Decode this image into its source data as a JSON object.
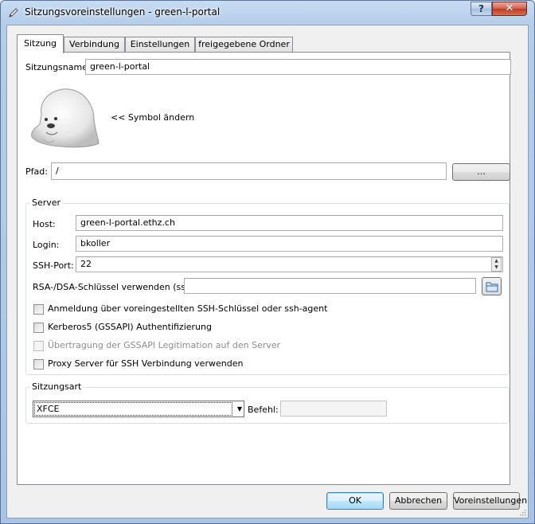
{
  "window": {
    "title": "Sitzungsvoreinstellungen - green-l-portal",
    "help_glyph": "?",
    "close_glyph": "✕"
  },
  "tabs": [
    {
      "label": "Sitzung",
      "active": true
    },
    {
      "label": "Verbindung"
    },
    {
      "label": "Einstellungen"
    },
    {
      "label": "freigegebene Ordner"
    }
  ],
  "session": {
    "name_label": "Sitzungsname:",
    "name_value": "green-l-portal",
    "change_icon_label": "<< Symbol ändern",
    "path_label": "Pfad:",
    "path_value": "/",
    "browse_label": "..."
  },
  "server": {
    "group_title": "Server",
    "host_label": "Host:",
    "host_value": "green-l-portal.ethz.ch",
    "login_label": "Login:",
    "login_value": "bkoller",
    "port_label": "SSH-Port:",
    "port_value": "22",
    "key_label": "RSA-/DSA-Schlüssel verwenden (ssh):",
    "key_value": "",
    "checkboxes": [
      {
        "label": "Anmeldung über voreingestellten SSH-Schlüssel oder ssh-agent",
        "checked": false,
        "enabled": true
      },
      {
        "label": "Kerberos5 (GSSAPI) Authentifizierung",
        "checked": false,
        "enabled": true
      },
      {
        "label": "Übertragung der GSSAPI Legitimation auf den Server",
        "checked": false,
        "enabled": false
      },
      {
        "label": "Proxy Server für SSH Verbindung verwenden",
        "checked": false,
        "enabled": true
      }
    ]
  },
  "session_type": {
    "group_title": "Sitzungsart",
    "selected": "XFCE",
    "command_label": "Befehl:",
    "command_value": ""
  },
  "buttons": {
    "ok": "OK",
    "cancel": "Abbrechen",
    "defaults": "Voreinstellungen"
  }
}
